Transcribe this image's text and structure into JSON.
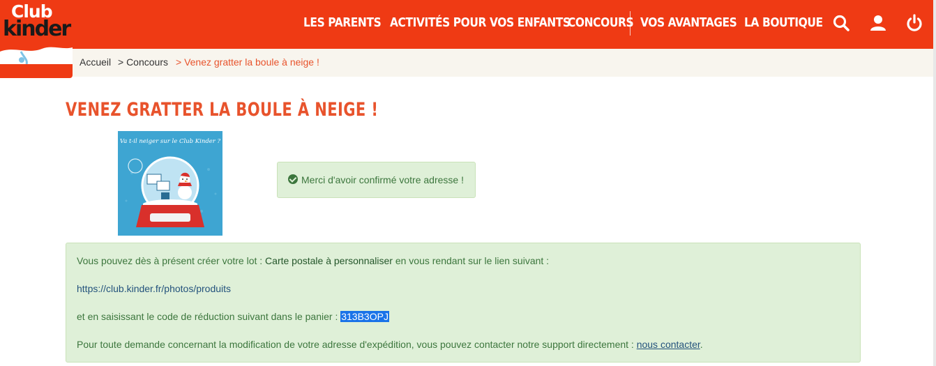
{
  "header": {
    "logo_line1": "Club",
    "logo_line2": "kinder",
    "nav": [
      "LES PARENTS",
      "ACTIVITÉS POUR VOS ENFANTS",
      "CONCOURS",
      "VOS AVANTAGES",
      "LA BOUTIQUE"
    ],
    "icons": [
      "search-icon",
      "user-icon",
      "power-icon"
    ],
    "brand_color": "#ef3a14"
  },
  "breadcrumb": {
    "items": [
      "Accueil",
      "> Concours",
      "> Venez gratter la boule à neige !"
    ]
  },
  "page": {
    "title": "VENEZ GRATTER LA BOULE À NEIGE !",
    "image_text": "Va t-il neiger sur le Club Kinder ?"
  },
  "confirmation": {
    "message": "Merci d'avoir confirmé votre adresse !"
  },
  "info": {
    "line1_prefix": "Vous pouvez dès à présent créer votre lot : ",
    "line1_prize": "Carte postale à personnaliser",
    "line1_suffix": " en vous rendant sur le lien suivant :",
    "link": "https://club.kinder.fr/photos/produits",
    "line3_prefix": "et en saisissant le code de réduction suivant dans le panier : ",
    "code": "313B3OPJ",
    "line4_prefix": "Pour toute demande concernant la modification de votre adresse d'expédition, vous pouvez contacter notre support directement : ",
    "contact_label": "nous contacter",
    "line4_suffix": "."
  }
}
